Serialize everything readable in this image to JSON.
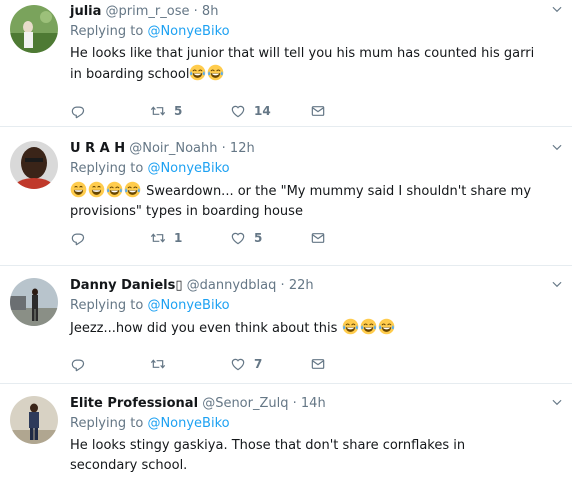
{
  "tweets": [
    {
      "name": "julia",
      "handle": "@prim_r_ose",
      "time": "8h",
      "replying_prefix": "Replying to",
      "replying_to": "@NonyeBiko",
      "text": "He looks like that junior that will tell you his mum has counted his garri in boarding school",
      "retweets": "5",
      "likes": "14"
    },
    {
      "name": "U R A H",
      "handle": "@Noir_Noahh",
      "time": "12h",
      "replying_prefix": "Replying to",
      "replying_to": "@NonyeBiko",
      "text": "Sweardown... or the \"My mummy said I shouldn't share my provisions\" types in boarding house",
      "retweets": "1",
      "likes": "5"
    },
    {
      "name": "Danny Daniels▯",
      "handle": "@dannydblaq",
      "time": "22h",
      "replying_prefix": "Replying to",
      "replying_to": "@NonyeBiko",
      "text": "Jeezz...how did you even think about this",
      "retweets": "",
      "likes": "7"
    },
    {
      "name": "Elite Professional",
      "handle": "@Senor_Zulq",
      "time": "14h",
      "replying_prefix": "Replying to",
      "replying_to": "@NonyeBiko",
      "text": "He looks stingy gaskiya. Those that don't share cornflakes in secondary school."
    }
  ],
  "icons": {
    "reply": "reply-icon",
    "retweet": "retweet-icon",
    "like": "heart-icon",
    "dm": "envelope-icon",
    "menu": "chevron-down-icon",
    "emoji": "tears-of-joy-emoji"
  },
  "colors": {
    "link": "#1da1f2",
    "secondary_text": "#657786",
    "divider": "#e6ecf0"
  }
}
